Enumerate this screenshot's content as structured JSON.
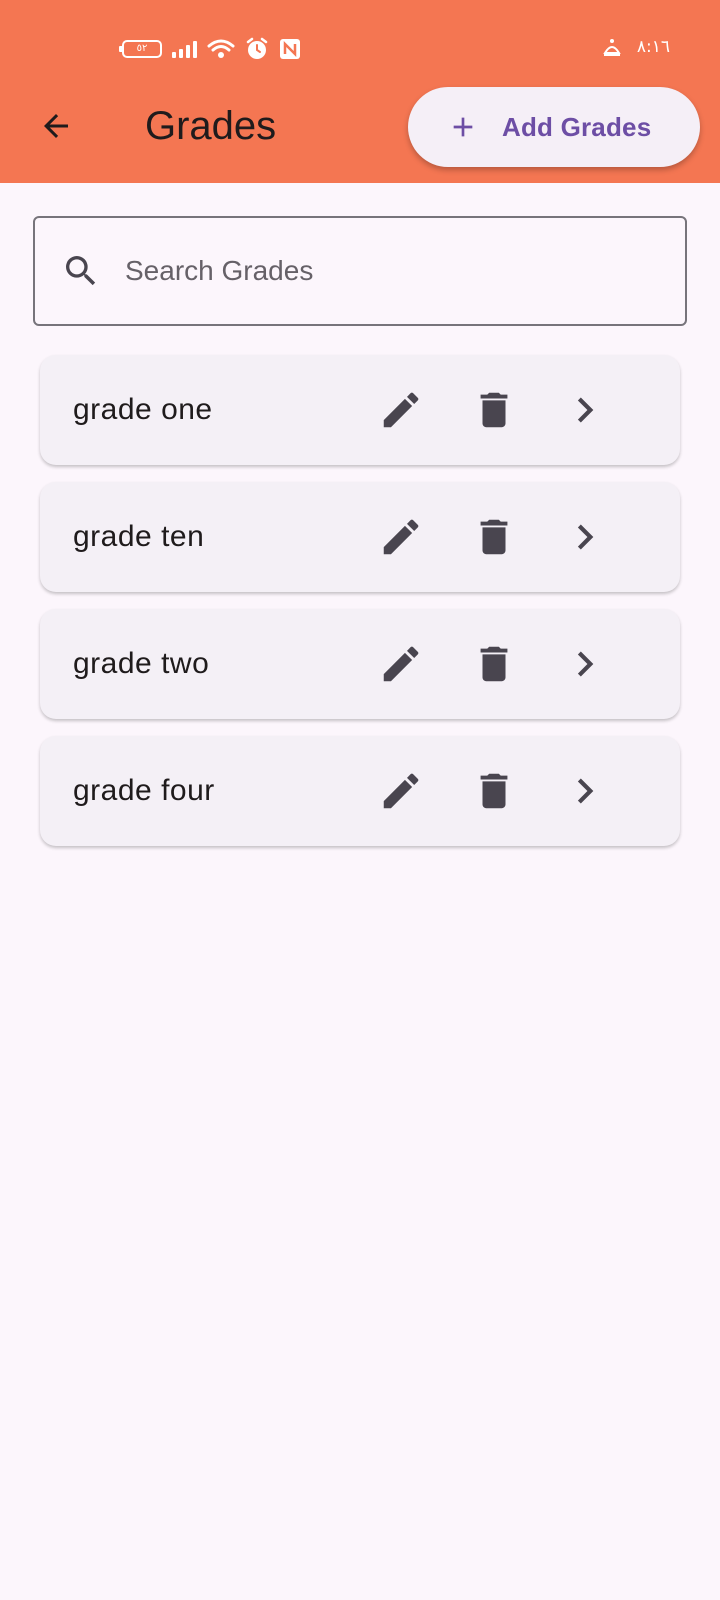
{
  "status_bar": {
    "battery": "٥٢",
    "time": "٨:١٦"
  },
  "app_bar": {
    "title": "Grades",
    "add_button_label": "Add Grades"
  },
  "search": {
    "placeholder": "Search Grades",
    "value": ""
  },
  "grades": [
    {
      "name": "grade one"
    },
    {
      "name": "grade ten"
    },
    {
      "name": "grade two"
    },
    {
      "name": "grade four"
    }
  ],
  "colors": {
    "header": "#f47652",
    "accent": "#6d4ea5",
    "background": "#fcf6fc",
    "card": "#f4f0f6",
    "icon": "#49454f"
  },
  "icons": {
    "back": "arrow-back-icon",
    "add": "plus-icon",
    "search": "search-icon",
    "edit": "pencil-icon",
    "delete": "trash-icon",
    "open": "chevron-right-icon"
  }
}
